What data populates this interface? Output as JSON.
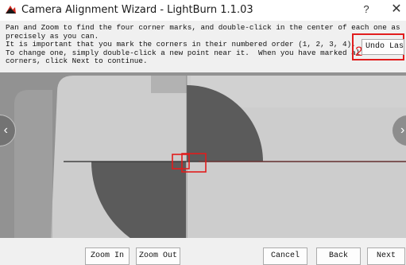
{
  "window": {
    "title": "Camera Alignment Wizard - LightBurn 1.1.03",
    "help_glyph": "?",
    "close_glyph": "✕"
  },
  "instructions": {
    "lines": [
      "Pan and Zoom to find the four corner marks, and double-click in the center of each one as",
      "precisely as you can.",
      "It is important that you mark the corners in their numbered order (1, 2, 3, 4).",
      "To change one, simply double-click a new point near it.  When you have marked all four",
      "corners, click Next to continue."
    ]
  },
  "undo": {
    "label": "Undo Last",
    "marker_number": "2"
  },
  "viewport": {
    "nav_left_glyph": "‹",
    "nav_right_glyph": "›"
  },
  "buttons": {
    "zoom_in": "Zoom In",
    "zoom_out": "Zoom Out",
    "cancel": "Cancel",
    "back": "Back",
    "next": "Next"
  },
  "colors": {
    "annotation_red": "#e11d1d",
    "camera_background": "#929292"
  }
}
